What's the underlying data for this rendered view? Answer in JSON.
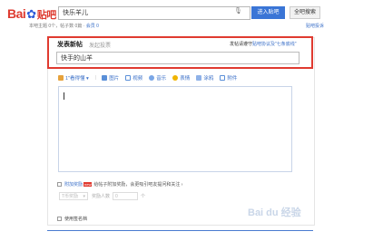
{
  "header": {
    "logo_text": "Bai",
    "logo_tieba": "贴吧",
    "search_value": "快乐羊儿",
    "enter_bar_label": "进入贴吧",
    "global_search_label": "全吧搜索",
    "breadcrumb_prefix": "本吧主题 0个，帖子数 0篇 · ",
    "breadcrumb_link": "会员 0",
    "help_link": "贴吧投诉"
  },
  "compose": {
    "tab_post": "发表新帖",
    "tab_vote": "发起投票",
    "rule_prefix": "发帖请遵守",
    "rule_link": "贴吧协议及\"七条底线\"",
    "title_value": "快手的山羊"
  },
  "toolbar": {
    "items": [
      {
        "label": "1\"看得懂 ▾",
        "icon": "picture-icon",
        "color": "#e6a23c"
      },
      {
        "label": "图片",
        "icon": "image-icon",
        "color": "#5a8fd8"
      },
      {
        "label": "视频",
        "icon": "video-icon",
        "color": "#5a8fd8"
      },
      {
        "label": "音乐",
        "icon": "music-icon",
        "color": "#5a8fd8"
      },
      {
        "label": "表情",
        "icon": "emoji-icon",
        "color": "#f0b400"
      },
      {
        "label": "涂鸦",
        "icon": "pen-icon",
        "color": "#5a8fd8"
      },
      {
        "label": "附件",
        "icon": "attach-icon",
        "color": "#5a8fd8"
      }
    ]
  },
  "options": {
    "paid_post_link": "附加奖励",
    "new_badge": "new",
    "paid_post_desc": "给帖子附加奖励，会更吸引吧友提问和关注 ›",
    "sel_placeholder": "T币奖励",
    "num_label": "奖励人数",
    "num_placeholder": "0",
    "unit": "个",
    "signature_label": "使用签名档"
  },
  "watermark": {
    "text": "Bai du 经验"
  },
  "colors": {
    "brand_red": "#de3a2f",
    "brand_blue": "#2d5bd8",
    "link_blue": "#3a6fc8",
    "highlight_red": "#e03a30"
  }
}
